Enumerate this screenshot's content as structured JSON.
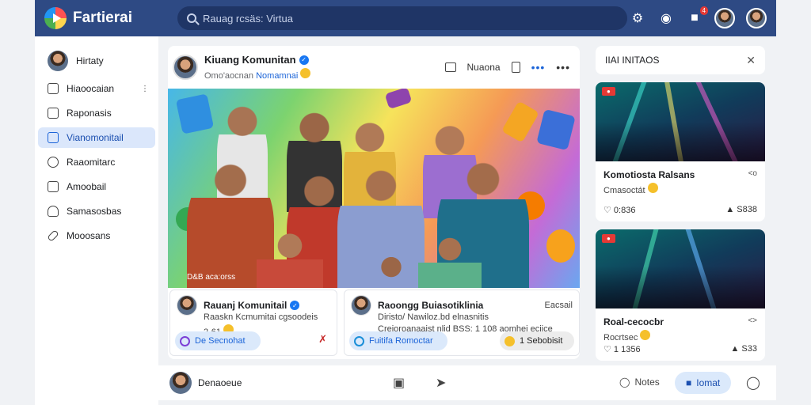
{
  "app": {
    "brand": "Fartierai"
  },
  "search": {
    "placeholder": "Rauag rcsäs: Virtua"
  },
  "topbar": {
    "notification_badge": "4"
  },
  "sidebar": {
    "profile": "Hirtaty",
    "items": [
      {
        "label": "Hiaoocaian",
        "icon": "calendar-icon",
        "active": false
      },
      {
        "label": "Raponasis",
        "icon": "page-icon",
        "active": false
      },
      {
        "label": "Vianomonitail",
        "icon": "group-icon",
        "active": true
      },
      {
        "label": "Raaomitarc",
        "icon": "clock-icon",
        "active": false
      },
      {
        "label": "Amoobail",
        "icon": "list-icon",
        "active": false
      },
      {
        "label": "Samasosbas",
        "icon": "cloud-icon",
        "active": false
      },
      {
        "label": "Mooosans",
        "icon": "link-icon",
        "active": false
      }
    ]
  },
  "post": {
    "author": "Kiuang Komunitan",
    "subtitle": "Omo'aocnan",
    "tag": "Nomamnai",
    "actions": {
      "share": "Nuaona"
    },
    "hero_caption": "D&B aca:orss",
    "cards": [
      {
        "author": "Rauanj Komunitail",
        "line1": "Raaskn Kcmumitai cgsoodeis",
        "line2": "2·61",
        "pill": "De Secnohat"
      },
      {
        "author": "Raoongg Buiasotiklinia",
        "right": "Eacsail",
        "line1": "Diristo/ Nawiloz.bd elnasnitis",
        "line2": "Creioroanaaist nlid BSS: 1 108 aomhei eciice",
        "pill": "Fuitifa Romoctar",
        "pill2": "1 Sebobisit"
      }
    ]
  },
  "compose": {
    "label": "Denaoeue",
    "notes": "Notes",
    "primary": "Iomat"
  },
  "right_panel": {
    "title": "IIAI INITAOS",
    "events": [
      {
        "title": "Komotiosta Ralsans",
        "title_right": "<o",
        "subtitle": "Cmasoctát",
        "left_stat": "0:836",
        "right_stat": "S838"
      },
      {
        "title": "Roal-cecocbr",
        "title_right": "<>",
        "subtitle": "Rocrtsec",
        "left_stat": "1 1356",
        "right_stat": "S33"
      }
    ]
  }
}
